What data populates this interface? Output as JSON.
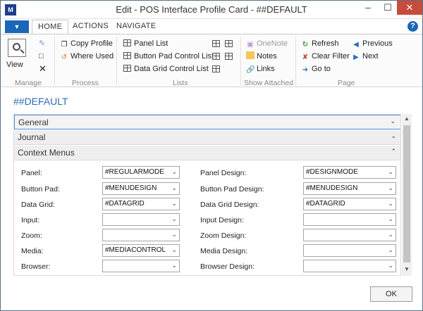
{
  "window": {
    "title": "Edit - POS Interface Profile Card - ##DEFAULT"
  },
  "ribbon": {
    "tabs": [
      "HOME",
      "ACTIONS",
      "NAVIGATE"
    ],
    "manage": {
      "label": "Manage",
      "view": "View"
    },
    "process": {
      "label": "Process",
      "copy_profile": "Copy Profile",
      "where_used": "Where Used"
    },
    "lists": {
      "label": "Lists",
      "panel_list": "Panel List",
      "button_pad_list": "Button Pad Control List",
      "data_grid_list": "Data Grid Control List"
    },
    "show_attached": {
      "label": "Show Attached",
      "onenote": "OneNote",
      "notes": "Notes",
      "links": "Links"
    },
    "page": {
      "label": "Page",
      "refresh": "Refresh",
      "clear_filter": "Clear Filter",
      "go_to": "Go to",
      "previous": "Previous",
      "next": "Next"
    }
  },
  "page_title": "##DEFAULT",
  "fasttabs": [
    "General",
    "Journal",
    "Context Menus"
  ],
  "left_fields": [
    {
      "label": "Panel:",
      "value": "#REGULARMODE"
    },
    {
      "label": "Button Pad:",
      "value": "#MENUDESIGN"
    },
    {
      "label": "Data Grid:",
      "value": "#DATAGRID"
    },
    {
      "label": "Input:",
      "value": ""
    },
    {
      "label": "Zoom:",
      "value": ""
    },
    {
      "label": "Media:",
      "value": "#MEDIACONTROL"
    },
    {
      "label": "Browser:",
      "value": ""
    }
  ],
  "right_fields": [
    {
      "label": "Panel Design:",
      "value": "#DESIGNMODE"
    },
    {
      "label": "Button Pad Design:",
      "value": "#MENUDESIGN"
    },
    {
      "label": "Data Grid Design:",
      "value": "#DATAGRID"
    },
    {
      "label": "Input Design:",
      "value": ""
    },
    {
      "label": "Zoom Design:",
      "value": ""
    },
    {
      "label": "Media Design:",
      "value": ""
    },
    {
      "label": "Browser Design:",
      "value": ""
    }
  ],
  "ok_label": "OK",
  "colors": {
    "accent": "#2a6fb5",
    "app_menu": "#1a67b8",
    "close": "#c74c3c"
  }
}
